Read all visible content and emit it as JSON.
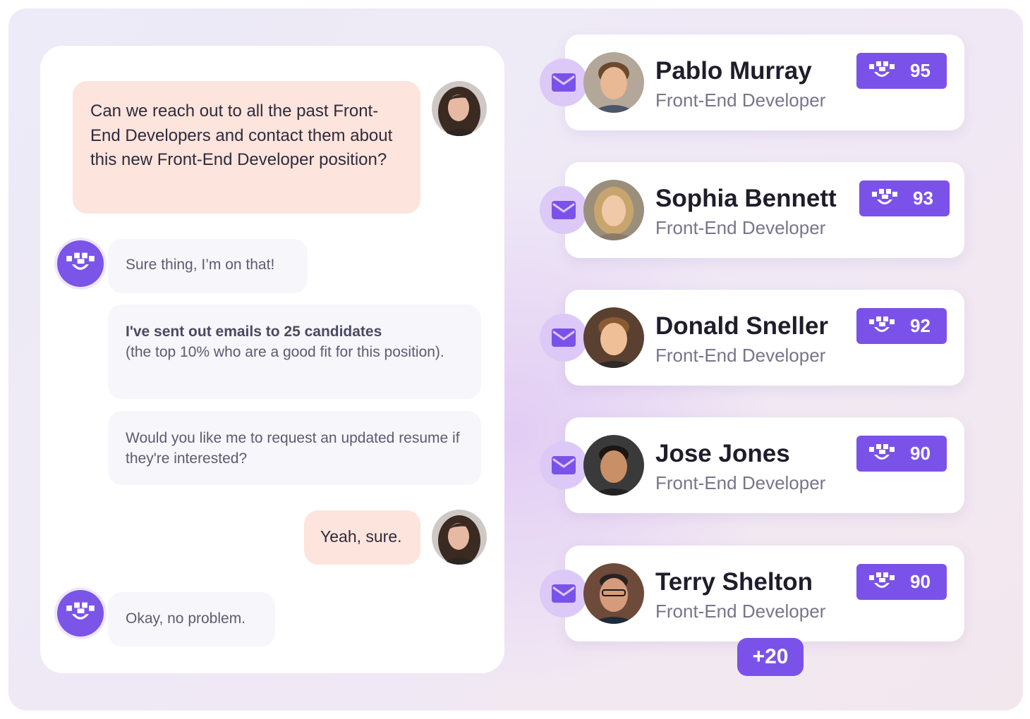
{
  "chat": {
    "messages": [
      {
        "sender": "user",
        "text": "Can we reach out to all the past Front-End Developers and contact them about this new Front-End Developer position?"
      },
      {
        "sender": "bot",
        "text": "Sure thing, I’m on that!"
      },
      {
        "sender": "bot",
        "bold": "I've sent out emails to 25 candidates",
        "text": "(the top 10% who are a good fit for this position)."
      },
      {
        "sender": "bot",
        "text": "Would you like me to request an updated resume if they're interested?"
      },
      {
        "sender": "user",
        "text": "Yeah, sure."
      },
      {
        "sender": "bot",
        "text": "Okay, no problem."
      }
    ]
  },
  "candidates": [
    {
      "name": "Pablo Murray",
      "role": "Front-End Developer",
      "score": "95"
    },
    {
      "name": "Sophia Bennett",
      "role": "Front-End Developer",
      "score": "93"
    },
    {
      "name": "Donald Sneller",
      "role": "Front-End Developer",
      "score": "92"
    },
    {
      "name": "Jose Jones",
      "role": "Front-End Developer",
      "score": "90"
    },
    {
      "name": "Terry Shelton",
      "role": "Front-End Developer",
      "score": "90"
    }
  ],
  "more_count": "+20",
  "icons": {
    "bot": "bot-face-icon",
    "mail": "envelope-icon",
    "score": "bot-face-icon"
  },
  "colors": {
    "accent": "#7b52e9",
    "user_bubble": "#fde4dc",
    "bot_bubble": "#f6f6fb",
    "mail_circle": "#dcc9f7"
  }
}
